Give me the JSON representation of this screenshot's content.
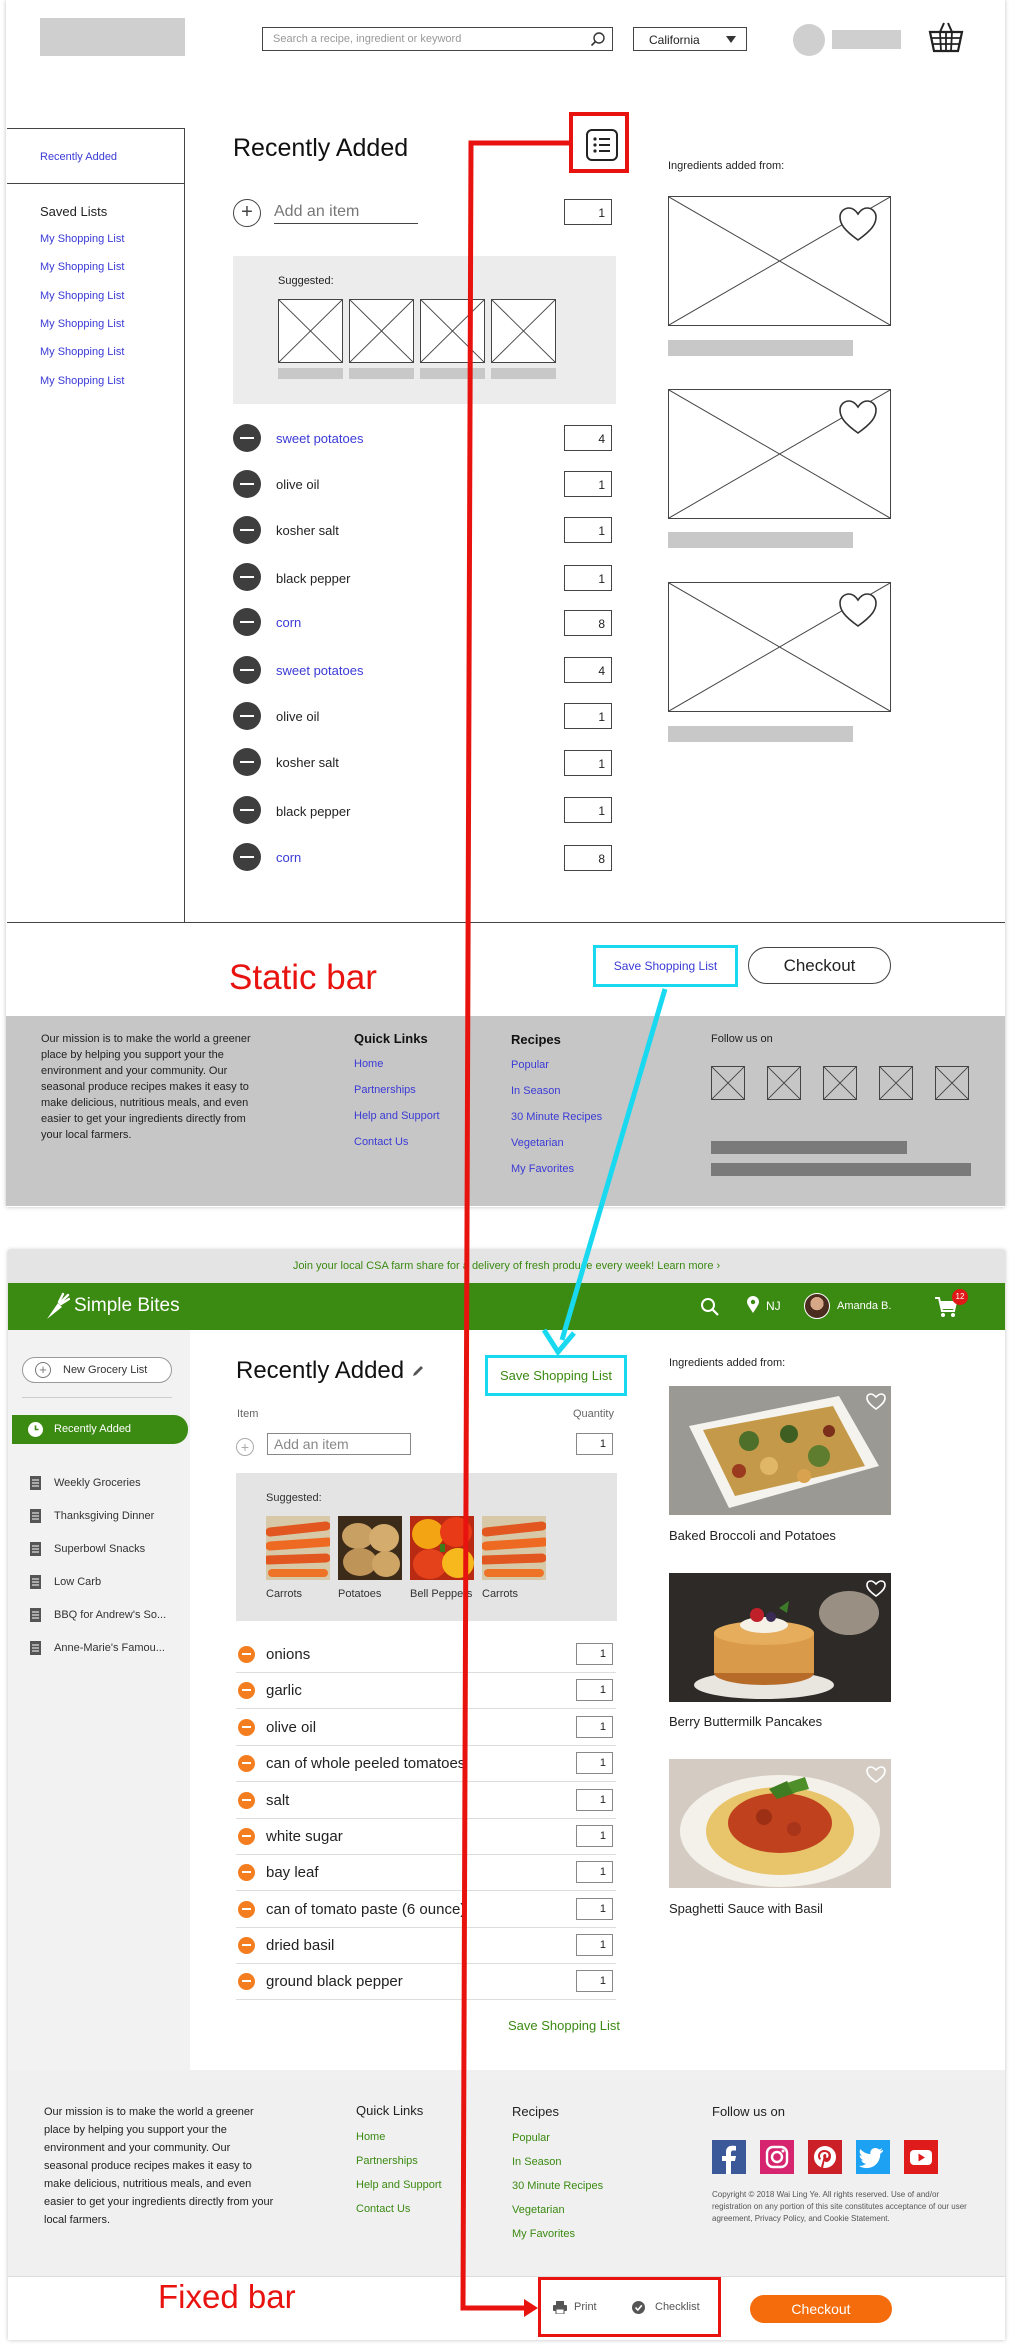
{
  "wireframe": {
    "search_placeholder": "Search a recipe, ingredient or keyword",
    "location": "California",
    "sidebar": {
      "recently_added": "Recently Added",
      "saved_lists_title": "Saved Lists",
      "lists": [
        "My Shopping List",
        "My Shopping List",
        "My Shopping List",
        "My Shopping List",
        "My Shopping List",
        "My Shopping List"
      ]
    },
    "title": "Recently Added",
    "add_placeholder": "Add an item",
    "add_qty": "1",
    "suggested_label": "Suggested:",
    "items": [
      {
        "name": "sweet potatoes",
        "qty": "4"
      },
      {
        "name": "olive oil",
        "qty": "1"
      },
      {
        "name": "kosher salt",
        "qty": "1"
      },
      {
        "name": "black pepper",
        "qty": "1"
      },
      {
        "name": "corn",
        "qty": "8"
      },
      {
        "name": "sweet potatoes",
        "qty": "4"
      },
      {
        "name": "olive oil",
        "qty": "1"
      },
      {
        "name": "kosher salt",
        "qty": "1"
      },
      {
        "name": "black pepper",
        "qty": "1"
      },
      {
        "name": "corn",
        "qty": "8"
      }
    ],
    "ingredients_from": "Ingredients added from:",
    "static_bar_label": "Static bar",
    "save_list": "Save Shopping List",
    "checkout": "Checkout",
    "footer": {
      "mission": "Our mission is to make the world a greener place by helping you support your the environment and your community. Our seasonal produce recipes makes it easy to make delicious, nutritious meals, and even easier to get your ingredients directly from your local farmers.",
      "quick_links_title": "Quick Links",
      "quick_links": [
        "Home",
        "Partnerships",
        "Help and Support",
        "Contact Us"
      ],
      "recipes_title": "Recipes",
      "recipes": [
        "Popular",
        "In Season",
        "30 Minute Recipes",
        "Vegetarian",
        "My Favorites"
      ],
      "follow": "Follow us on"
    }
  },
  "mockup": {
    "banner": "Join your local CSA farm share for a delivery of fresh produce every week!  Learn more ›",
    "brand": "Simple Bites",
    "location": "NJ",
    "user": "Amanda B.",
    "cart_count": "12",
    "sidebar": {
      "new_list": "New Grocery List",
      "active": "Recently Added",
      "lists": [
        "Weekly Groceries",
        "Thanksgiving Dinner",
        "Superbowl Snacks",
        "Low Carb",
        "BBQ for Andrew's So...",
        "Anne-Marie's Famou..."
      ]
    },
    "title": "Recently Added",
    "save_list": "Save Shopping List",
    "item_col": "Item",
    "quantity_col": "Quantity",
    "add_placeholder": "Add an item",
    "add_qty": "1",
    "suggested_label": "Suggested:",
    "suggestions": [
      "Carrots",
      "Potatoes",
      "Bell Peppers",
      "Carrots"
    ],
    "items": [
      {
        "name": "onions",
        "qty": "1"
      },
      {
        "name": "garlic",
        "qty": "1"
      },
      {
        "name": "olive oil",
        "qty": "1"
      },
      {
        "name": "can of whole peeled tomatoes",
        "qty": "1"
      },
      {
        "name": "salt",
        "qty": "1"
      },
      {
        "name": "white sugar",
        "qty": "1"
      },
      {
        "name": "bay leaf",
        "qty": "1"
      },
      {
        "name": "can of tomato paste (6 ounce)",
        "qty": "1"
      },
      {
        "name": "dried basil",
        "qty": "1"
      },
      {
        "name": "ground black pepper",
        "qty": "1"
      }
    ],
    "ingredients_from": "Ingredients added from:",
    "recipes": [
      "Baked Broccoli and Potatoes",
      "Berry Buttermilk Pancakes",
      "Spaghetti Sauce with Basil"
    ],
    "footer": {
      "mission": "Our mission is to make the world a greener place by helping you support your the environment and your community. Our seasonal produce recipes makes it easy to make delicious, nutritious meals, and even easier to get your ingredients directly from your local farmers.",
      "quick_links_title": "Quick Links",
      "quick_links": [
        "Home",
        "Partnerships",
        "Help and Support",
        "Contact Us"
      ],
      "recipes_title": "Recipes",
      "recipes": [
        "Popular",
        "In Season",
        "30 Minute Recipes",
        "Vegetarian",
        "My Favorites"
      ],
      "follow": "Follow us on",
      "copyright": "Copyright © 2018 Wai Ling Ye. All rights reserved. Use of and/or registration on any portion of this site constitutes acceptance of our user agreement, Privacy Policy, and Cookie Statement."
    },
    "fixed_bar_label": "Fixed bar",
    "print": "Print",
    "checklist": "Checklist",
    "checkout": "Checkout"
  },
  "colors": {
    "brand_green": "#3b8a12",
    "accent_orange": "#f46c0c",
    "annotation_red": "#e8130f",
    "annotation_cyan": "#19d9f0",
    "wire_link": "#3a3ad6"
  }
}
